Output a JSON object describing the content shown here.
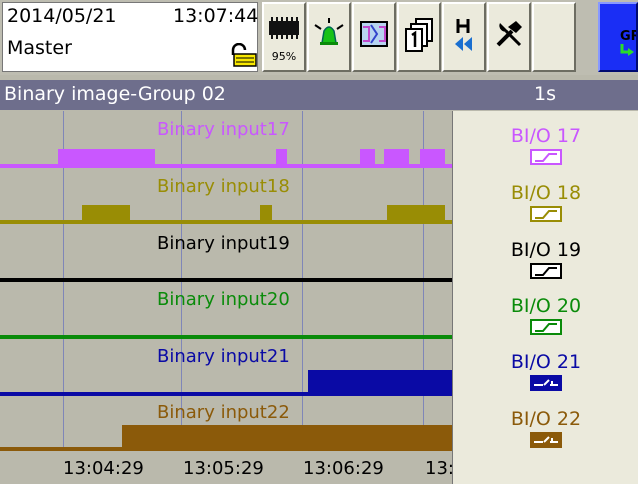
{
  "status": {
    "date": "2014/05/21",
    "time": "13:07:44",
    "user": "Master",
    "memory_percent": "95%"
  },
  "toolbar": {
    "buttons": [
      {
        "name": "memory-status-button",
        "icon": "memory-chip-icon"
      },
      {
        "name": "alarm-button",
        "icon": "alarm-bell-icon"
      },
      {
        "name": "display-mode-button",
        "icon": "display-mode-icon"
      },
      {
        "name": "group-select-button",
        "icon": "group-pages-icon"
      },
      {
        "name": "history-button",
        "icon": "history-rewind-icon"
      },
      {
        "name": "tools-button",
        "icon": "tools-icon"
      },
      {
        "name": "blank-button",
        "icon": ""
      },
      {
        "name": "group-next-button",
        "icon": "group-next-icon",
        "label": "GR"
      }
    ]
  },
  "title": {
    "text": "Binary image-Group 02",
    "interval": "1s"
  },
  "colors": {
    "bi17": "#c957ff",
    "bi18": "#998d05",
    "bi19": "#000000",
    "bi20": "#0a8b0a",
    "bi21": "#0a0aa5",
    "bi22": "#8b5a0a"
  },
  "chart_data": {
    "type": "line",
    "x": [
      "13:04:29",
      "13:05:29",
      "13:06:29",
      "13:"
    ],
    "series": [
      {
        "name": "Binary input17",
        "legend": "BI/O 17",
        "color": "#c957ff"
      },
      {
        "name": "Binary input18",
        "legend": "BI/O 18",
        "color": "#998d05"
      },
      {
        "name": "Binary input19",
        "legend": "BI/O 19",
        "color": "#000000"
      },
      {
        "name": "Binary input20",
        "legend": "BI/O 20",
        "color": "#0a8b0a"
      },
      {
        "name": "Binary input21",
        "legend": "BI/O 21",
        "color": "#0a0aa5"
      },
      {
        "name": "Binary input22",
        "legend": "BI/O 22",
        "color": "#8b5a0a"
      }
    ]
  }
}
